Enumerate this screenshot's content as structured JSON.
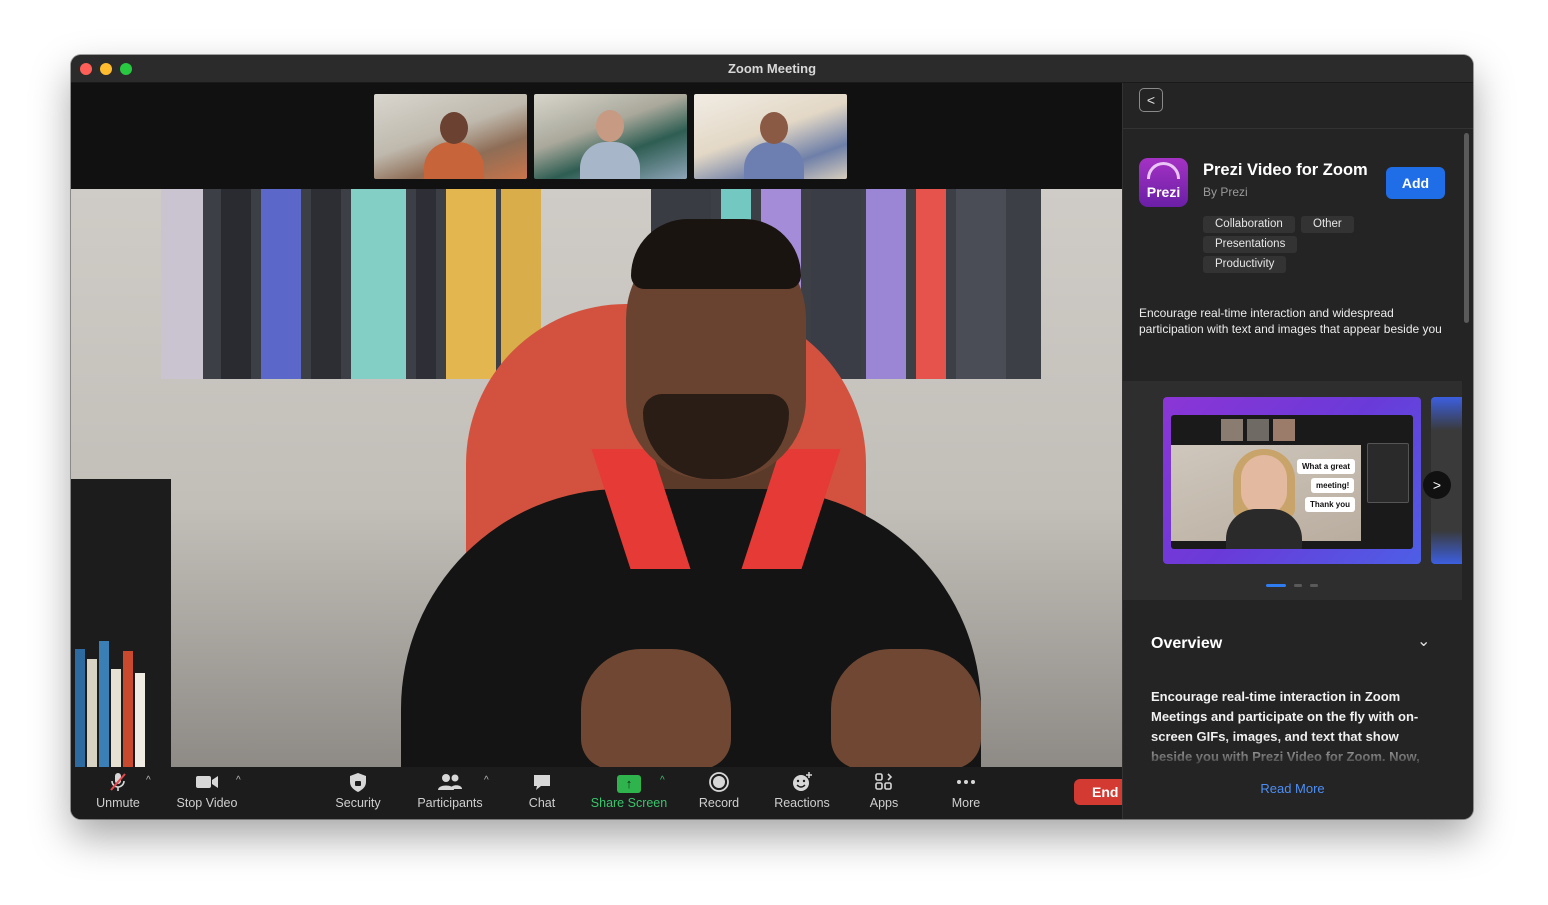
{
  "window": {
    "title": "Zoom Meeting"
  },
  "toolbar": {
    "unmute": "Unmute",
    "stop_video": "Stop Video",
    "security": "Security",
    "participants": "Participants",
    "chat": "Chat",
    "share_screen": "Share Screen",
    "record": "Record",
    "reactions": "Reactions",
    "apps": "Apps",
    "more": "More",
    "end": "End",
    "caret": "^"
  },
  "panel": {
    "back": "<",
    "app": {
      "logo_text": "Prezi",
      "name": "Prezi Video for Zoom",
      "by": "By Prezi",
      "add_label": "Add",
      "tags": [
        "Collaboration",
        "Other",
        "Presentations",
        "Productivity"
      ],
      "short_description": "Encourage real-time interaction and widespread participation with text and images that appear beside you"
    },
    "carousel": {
      "bubbles": [
        "What a great",
        "meeting!",
        "Thank you"
      ],
      "next": ">"
    },
    "overview": {
      "title": "Overview",
      "chevron": "⌄",
      "text": "Encourage real-time interaction in Zoom Meetings and participate on the fly with on-screen GIFs, images, and text that show beside you with Prezi Video for Zoom. Now,",
      "read_more": "Read More"
    }
  },
  "colors": {
    "accent_blue": "#1f6ee8",
    "share_green": "#39c56b",
    "end_red": "#d33a32",
    "prezi_purple": "#8c35d6"
  },
  "icons": {
    "unmute": "muted-microphone-icon",
    "stop_video": "video-camera-icon",
    "security": "shield-icon",
    "participants": "people-icon",
    "chat": "chat-bubble-icon",
    "share_screen": "share-screen-arrow-icon",
    "record": "record-circle-icon",
    "reactions": "emoji-plus-icon",
    "apps": "apps-icon",
    "more": "ellipsis-icon"
  }
}
